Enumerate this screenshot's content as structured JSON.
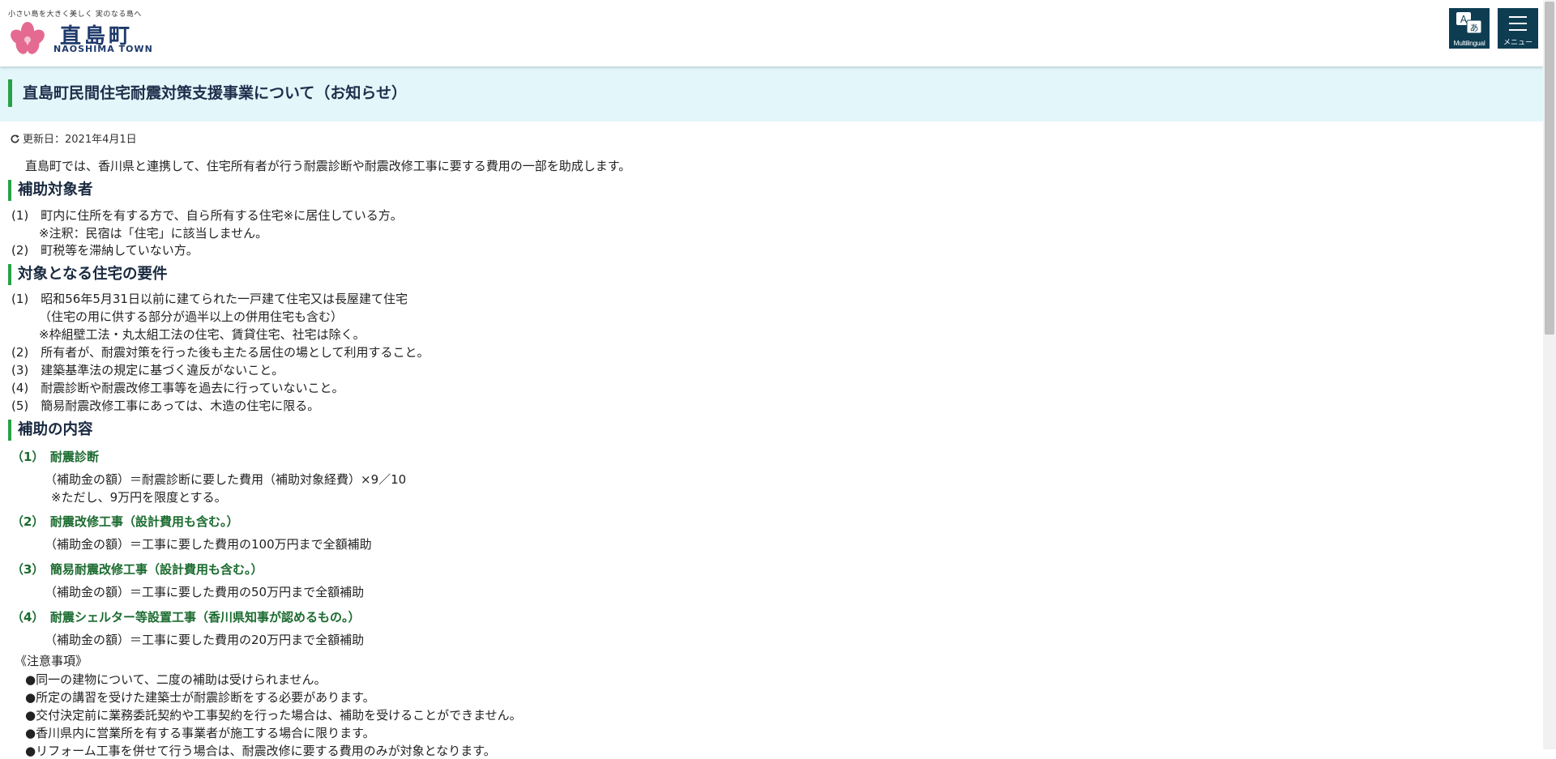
{
  "header": {
    "tagline": "小さい島を大きく美しく 実のなる島へ",
    "site_name": "直島町",
    "site_name_en": "NAOSHIMA TOWN",
    "multilingual_label": "Multilingual",
    "menu_label": "メニュー",
    "accent_color": "#0e3d52"
  },
  "page": {
    "title": "直島町民間住宅耐震対策支援事業について（お知らせ）",
    "updated": "更新日：2021年4月1日",
    "intro": "直島町では、香川県と連携して、住宅所有者が行う耐震診断や耐震改修工事に要する費用の一部を助成します。"
  },
  "sections": {
    "target": {
      "heading": "補助対象者",
      "lines": [
        "(1)　町内に住所を有する方で、自ら所有する住宅※に居住している方。",
        "※注釈：民宿は「住宅」に該当しません。",
        "(2)　町税等を滞納していない方。"
      ]
    },
    "requirements": {
      "heading": "対象となる住宅の要件",
      "lines": [
        "(1)　昭和56年5月31日以前に建てられた一戸建て住宅又は長屋建て住宅",
        "（住宅の用に供する部分が過半以上の併用住宅も含む）",
        "※枠組壁工法・丸太組工法の住宅、賃貸住宅、社宅は除く。",
        "(2)　所有者が、耐震対策を行った後も主たる居住の場として利用すること。",
        "(3)　建築基準法の規定に基づく違反がないこと。",
        "(4)　耐震診断や耐震改修工事等を過去に行っていないこと。",
        "(5)　簡易耐震改修工事にあっては、木造の住宅に限る。"
      ]
    },
    "content": {
      "heading": "補助の内容",
      "items": [
        {
          "title": "（1）　耐震診断",
          "lines": [
            "（補助金の額）＝耐震診断に要した費用（補助対象経費）×9／10",
            "※ただし、9万円を限度とする。"
          ]
        },
        {
          "title": "（2）　耐震改修工事（設計費用も含む。）",
          "lines": [
            "（補助金の額）＝工事に要した費用の100万円まで全額補助"
          ]
        },
        {
          "title": "（3）　簡易耐震改修工事（設計費用も含む。）",
          "lines": [
            "（補助金の額）＝工事に要した費用の50万円まで全額補助"
          ]
        },
        {
          "title": "（4）　耐震シェルター等設置工事（香川県知事が認めるもの。）",
          "lines": [
            "（補助金の額）＝工事に要した費用の20万円まで全額補助"
          ]
        }
      ],
      "notes_heading": "《注意事項》",
      "notes": [
        "●同一の建物について、二度の補助は受けられません。",
        "●所定の講習を受けた建築士が耐震診断をする必要があります。",
        "●交付決定前に業務委託契約や工事契約を行った場合は、補助を受けることができません。",
        "●香川県内に営業所を有する事業者が施工する場合に限ります。",
        "●リフォーム工事を併せて行う場合は、耐震改修に要する費用のみが対象となります。"
      ]
    }
  },
  "colors": {
    "title_band_bg": "#e3f6fa",
    "heading_bar": "#28a146",
    "subheading_text": "#1b6b2f"
  }
}
